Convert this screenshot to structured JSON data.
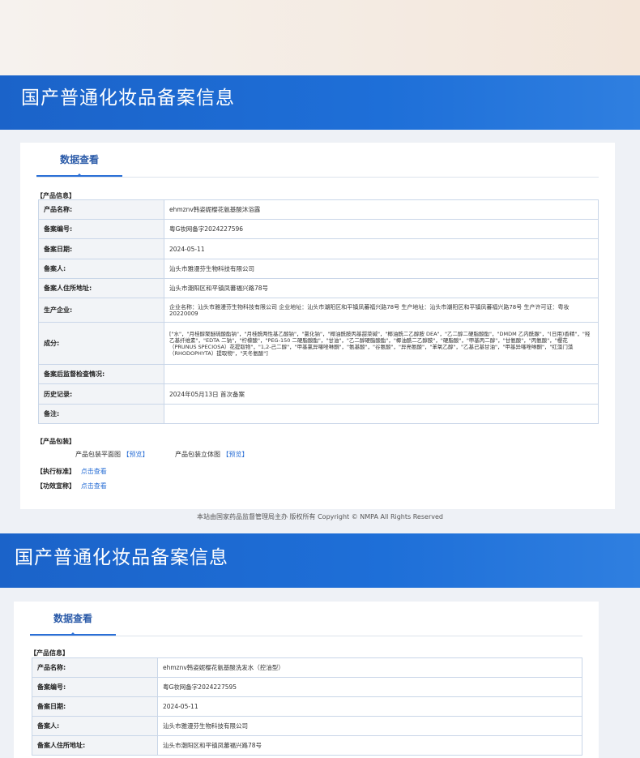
{
  "banner_title": "国产普通化妆品备案信息",
  "tab_label": "数据查看",
  "section1": {
    "product_info_label": "【产品信息】",
    "rows": [
      {
        "key": "产品名称:",
        "value": "ehmznv韩姿妮樱花氨基酸沐浴露"
      },
      {
        "key": "备案编号:",
        "value": "粤G妆网备字2024227596"
      },
      {
        "key": "备案日期:",
        "value": "2024-05-11"
      },
      {
        "key": "备案人:",
        "value": "汕头市雅漫芬生物科技有限公司"
      },
      {
        "key": "备案人住所地址:",
        "value": "汕头市潮阳区和平镇凤蕃福兴路78号"
      },
      {
        "key": "生产企业:",
        "value": "企业名称：汕头市雅漫芬生物科技有限公司 企业地址：汕头市潮阳区和平镇凤蕃福兴路78号 生产地址：汕头市潮阳区和平镇凤蕃福兴路78号 生产许可证：粤妆20220009"
      },
      {
        "key": "成分:",
        "value": "[\"水\"，\"月桂醇聚醚硫酸酯钠\"，\"月桂酰两性基乙酸钠\"，\"氯化钠\"，\"椰油酰胺丙基甜菜碱\"，\"椰油酰二乙醇胺 DEA\"，\"乙二醇二硬脂酸酯\"，\"DMDM 乙内酰脲\"，\"(日用)香精\"，\"羟乙基纤维素\"，\"EDTA 二钠\"，\"柠檬酸\"，\"PEG-150 二硬脂酸酯\"，\"甘油\"，\"乙二醇硬脂酸酯\"，\"椰油酰二乙醇胺\"，\"硬脂酸\"，\"甲基丙二醇\"，\"甘氨酸\"，\"丙氨酸\"，\"樱花（PRUNUS SPECIOSA）花提取物\"，\"1,2-己二醇\"，\"甲基氯异噻唑啉酮\"，\"氨基酸\"，\"谷氨酸\"，\"异亮氨酸\"，\"苯氧乙醇\"，\"乙基己基甘油\"，\"甲基异噻唑啉酮\"，\"红藻门藻（RHODOPHYTA）提取物\"，\"天冬氨酸\"]"
      },
      {
        "key": "备案后监督检查情况:",
        "value": ""
      },
      {
        "key": "历史记录:",
        "value": "2024年05月13日 首次备案"
      },
      {
        "key": "备注:",
        "value": ""
      }
    ],
    "package_label": "【产品包装】",
    "package_flat": "产品包装平面图",
    "package_3d": "产品包装立体图",
    "preview_link": "【预览】",
    "standard_label": "【执行标准】",
    "efficacy_label": "【功效宣称】",
    "view_link": "点击查看"
  },
  "footer": "本站由国家药品监督管理局主办 版权所有 Copyright © NMPA All Rights Reserved",
  "section2": {
    "product_info_label": "【产品信息】",
    "rows": [
      {
        "key": "产品名称:",
        "value": "ehmznv韩姿妮樱花氨基酸洗发水（控油型）"
      },
      {
        "key": "备案编号:",
        "value": "粤G妆网备字2024227595"
      },
      {
        "key": "备案日期:",
        "value": "2024-05-11"
      },
      {
        "key": "备案人:",
        "value": "汕头市雅漫芬生物科技有限公司"
      },
      {
        "key": "备案人住所地址:",
        "value": "汕头市潮阳区和平镇凤蕃福兴路78号"
      }
    ]
  }
}
